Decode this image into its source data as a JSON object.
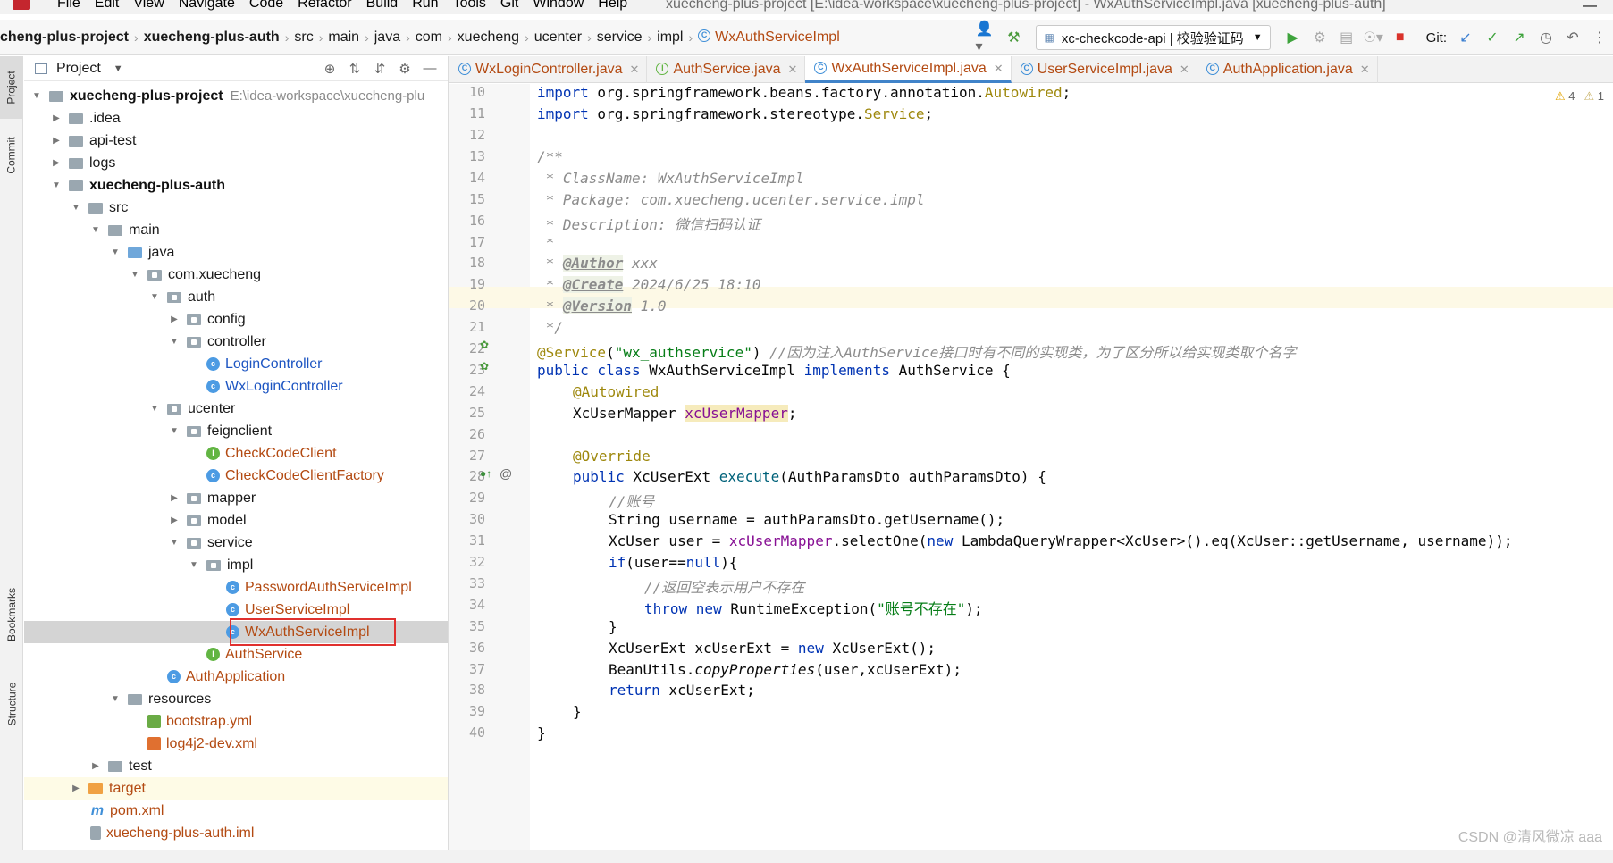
{
  "window": {
    "title": "xuecheng-plus-project [E:\\idea-workspace\\xuecheng-plus-project] - WxAuthServiceImpl.java [xuecheng-plus-auth]",
    "minimize": "—"
  },
  "menu": [
    "File",
    "Edit",
    "View",
    "Navigate",
    "Code",
    "Refactor",
    "Build",
    "Run",
    "Tools",
    "Git",
    "Window",
    "Help"
  ],
  "breadcrumbs": [
    "cheng-plus-project",
    "xuecheng-plus-auth",
    "src",
    "main",
    "java",
    "com",
    "xuecheng",
    "ucenter",
    "service",
    "impl",
    "WxAuthServiceImpl"
  ],
  "toolbar": {
    "run_config": "xc-checkcode-api | 校验验证码",
    "git_label": "Git:"
  },
  "left_stripe": [
    "Project",
    "Commit",
    "Bookmarks",
    "Structure"
  ],
  "project_panel": {
    "title": "Project",
    "tree": [
      {
        "label": "xuecheng-plus-project",
        "path": "E:\\idea-workspace\\xuecheng-plu"
      },
      {
        "label": ".idea"
      },
      {
        "label": "api-test"
      },
      {
        "label": "logs"
      },
      {
        "label": "xuecheng-plus-auth"
      },
      {
        "label": "src"
      },
      {
        "label": "main"
      },
      {
        "label": "java"
      },
      {
        "label": "com.xuecheng"
      },
      {
        "label": "auth"
      },
      {
        "label": "config"
      },
      {
        "label": "controller"
      },
      {
        "label": "LoginController"
      },
      {
        "label": "WxLoginController"
      },
      {
        "label": "ucenter"
      },
      {
        "label": "feignclient"
      },
      {
        "label": "CheckCodeClient"
      },
      {
        "label": "CheckCodeClientFactory"
      },
      {
        "label": "mapper"
      },
      {
        "label": "model"
      },
      {
        "label": "service"
      },
      {
        "label": "impl"
      },
      {
        "label": "PasswordAuthServiceImpl"
      },
      {
        "label": "UserServiceImpl"
      },
      {
        "label": "WxAuthServiceImpl"
      },
      {
        "label": "AuthService"
      },
      {
        "label": "AuthApplication"
      },
      {
        "label": "resources"
      },
      {
        "label": "bootstrap.yml"
      },
      {
        "label": "log4j2-dev.xml"
      },
      {
        "label": "test"
      },
      {
        "label": "target"
      },
      {
        "label": "pom.xml"
      },
      {
        "label": "xuecheng-plus-auth.iml"
      }
    ]
  },
  "tabs": [
    {
      "label": "WxLoginController.java"
    },
    {
      "label": "AuthService.java"
    },
    {
      "label": "WxAuthServiceImpl.java",
      "active": true
    },
    {
      "label": "UserServiceImpl.java"
    },
    {
      "label": "AuthApplication.java"
    }
  ],
  "editor": {
    "inspections": {
      "warnings": "4",
      "weak_warnings": "1"
    },
    "line_numbers": [
      "10",
      "11",
      "12",
      "13",
      "14",
      "15",
      "16",
      "17",
      "18",
      "19",
      "20",
      "21",
      "22",
      "23",
      "24",
      "25",
      "26",
      "27",
      "28",
      "29",
      "30",
      "31",
      "32",
      "33",
      "34",
      "35",
      "36",
      "37",
      "38",
      "39",
      "40"
    ],
    "code": {
      "l10": {
        "kw": "import",
        "pkg": " org.springframework.beans.factory.annotation.",
        "ann": "Autowired",
        "end": ";"
      },
      "l11": {
        "kw": "import",
        "pkg": " org.springframework.stereotype.",
        "ann": "Service",
        "end": ";"
      },
      "l13": "/**",
      "l14": " * ClassName: WxAuthServiceImpl",
      "l15": " * Package: com.xuecheng.ucenter.service.impl",
      "l16a": " * Description: ",
      "l16b": "微信扫码认证",
      "l17": " *",
      "l18a": " * ",
      "l18tag": "@Author",
      "l18b": " xxx",
      "l19a": " * ",
      "l19tag": "@Create",
      "l19b": " 2024/6/25 18:10",
      "l20a": " * ",
      "l20tag": "@Version",
      "l20b": " 1.0",
      "l21": " */",
      "l22ann": "@Service",
      "l22p1": "(",
      "l22str": "\"wx_authservice\"",
      "l22p2": ") ",
      "l22cmt": "//因为注入AuthService接口时有不同的实现类，为了区分所以给实现类取个名字",
      "l23a": "public class",
      "l23b": " WxAuthServiceImpl ",
      "l23c": "implements",
      "l23d": " AuthService {",
      "l24": "@Autowired",
      "l25a": "XcUserMapper ",
      "l25b": "xcUserMapper",
      "l25c": ";",
      "l27": "@Override",
      "l28a": "public",
      "l28b": " XcUserExt ",
      "l28c": "execute",
      "l28d": "(AuthParamsDto authParamsDto) {",
      "l29": "//账号",
      "l30": "String username = authParamsDto.getUsername();",
      "l31a": "XcUser user = ",
      "l31b": "xcUserMapper",
      "l31c": ".selectOne(",
      "l31d": "new",
      "l31e": " LambdaQueryWrapper<XcUser>().eq(XcUser::getUsername, username));",
      "l32a": "if",
      "l32b": "(user==",
      "l32c": "null",
      "l32d": "){",
      "l33": "//返回空表示用户不存在",
      "l34a": "throw new",
      "l34b": " RuntimeException(",
      "l34c": "\"账号不存在\"",
      "l34d": ");",
      "l35": "}",
      "l36a": "XcUserExt xcUserExt = ",
      "l36b": "new",
      "l36c": " XcUserExt();",
      "l37a": "BeanUtils.",
      "l37b": "copyProperties",
      "l37c": "(user,xcUserExt);",
      "l38a": "return",
      "l38b": " xcUserExt;",
      "l39": "}",
      "l40": "}"
    },
    "gutter_at": "@"
  },
  "watermark": "CSDN @清风微凉 aaa"
}
